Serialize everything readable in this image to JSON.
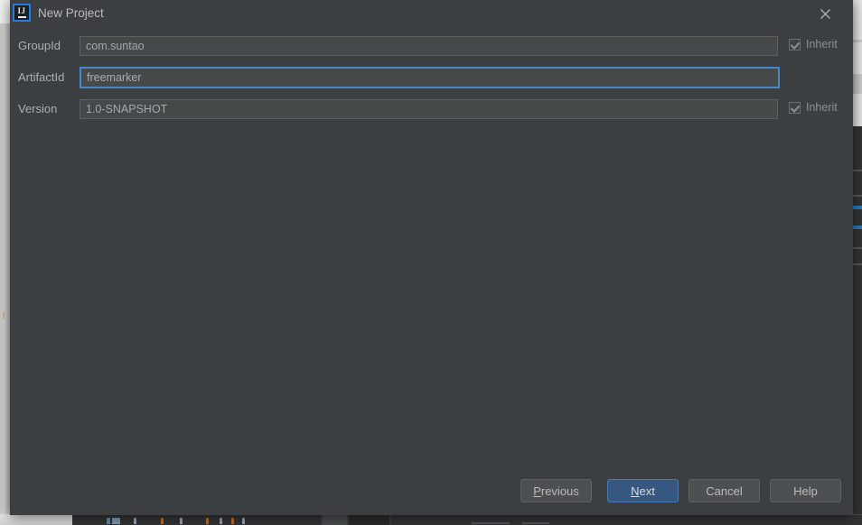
{
  "dialog": {
    "title": "New Project",
    "app_icon": "intellij-idea-icon",
    "icon_text": "IJ",
    "close_icon": "close-icon"
  },
  "form": {
    "fields": [
      {
        "label": "GroupId",
        "value": "com.suntao",
        "focused": false,
        "inherit": {
          "label": "Inherit",
          "checked": true,
          "enabled": false
        }
      },
      {
        "label": "ArtifactId",
        "value": "freemarker",
        "focused": true,
        "inherit": null
      },
      {
        "label": "Version",
        "value": "1.0-SNAPSHOT",
        "focused": false,
        "inherit": {
          "label": "Inherit",
          "checked": true,
          "enabled": false
        }
      }
    ]
  },
  "buttons": {
    "previous": {
      "prefix": "",
      "mnemonic": "P",
      "suffix": "revious"
    },
    "next": {
      "prefix": "",
      "mnemonic": "N",
      "suffix": "ext",
      "default": true
    },
    "cancel": {
      "label": "Cancel"
    },
    "help": {
      "label": "Help"
    }
  },
  "colors": {
    "dialog_background": "#3c3f41",
    "field_background": "#45494a",
    "focus_border": "#4a88c7",
    "default_button": "#365880",
    "label_text": "#a9b0b4",
    "ide_background": "#2b2b2b"
  }
}
